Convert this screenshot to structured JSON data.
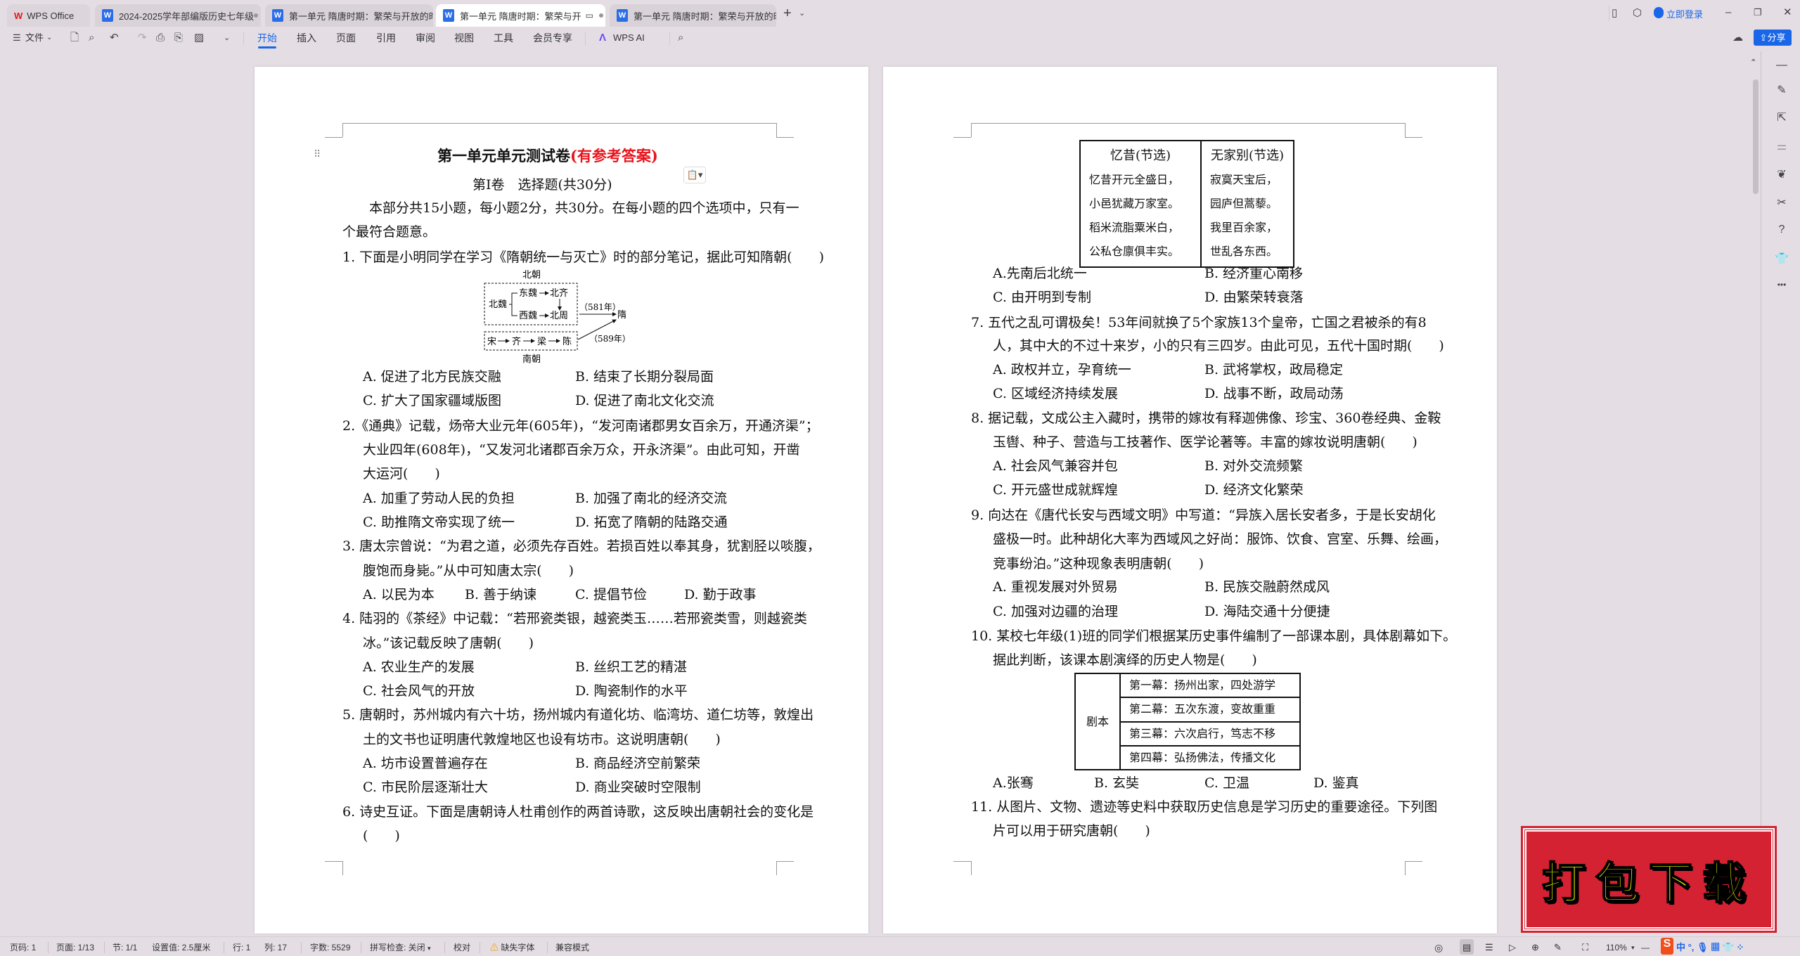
{
  "titlebar": {
    "app_tab": "WPS Office",
    "tabs": [
      {
        "label": "2024-2025学年部编版历史七年级",
        "active": false
      },
      {
        "label": "第一单元 隋唐时期：繁荣与开放的时代",
        "active": false
      },
      {
        "label": "第一单元 隋唐时期：繁荣与开",
        "active": true
      },
      {
        "label": "第一单元 隋唐时期：繁荣与开放的时代",
        "active": false
      }
    ],
    "new_tab": "+",
    "login": "立即登录",
    "share": "分享"
  },
  "ribbon": {
    "file": "文件",
    "tabs": [
      "开始",
      "插入",
      "页面",
      "引用",
      "审阅",
      "视图",
      "工具",
      "会员专享"
    ],
    "active_tab": "开始",
    "ai": "WPS AI"
  },
  "left_page": {
    "title": "第一单元单元测试卷",
    "title_note": "(有参考答案)",
    "section": "第Ⅰ卷　选择题(共30分)",
    "intro": [
      "本部分共15小题，每小题2分，共30分。在每小题的四个选项中，只有一",
      "个最符合题意。"
    ],
    "q1": {
      "stem": "1. 下面是小明同学在学习《隋朝统一与灭亡》时的部分笔记，据此可知隋朝(　　)",
      "diagram": {
        "north": "北朝",
        "south": "南朝",
        "beiwei": "北魏",
        "dongwei": "东魏",
        "beiqi": "北齐",
        "xiwei": "西魏",
        "beizhou": "北周",
        "y581": "（581年）",
        "y589": "（589年）",
        "sui": "隋",
        "song": "宋",
        "qi": "齐",
        "liang": "梁",
        "chen": "陈"
      },
      "A": "A.  促进了北方民族交融",
      "B": "B.  结束了长期分裂局面",
      "C": "C.  扩大了国家疆域版图",
      "D": "D.  促进了南北文化交流"
    },
    "q2": {
      "lines": [
        "2.《通典》记载，炀帝大业元年(605年)，“发河南诸郡男女百余万，开通济渠”；",
        "大业四年(608年)，“又发河北诸郡百余万众，开永济渠”。由此可知，开凿",
        "大运河(　　)"
      ],
      "A": "A.  加重了劳动人民的负担",
      "B": "B.  加强了南北的经济交流",
      "C": "C.  助推隋文帝实现了统一",
      "D": "D.  拓宽了隋朝的陆路交通"
    },
    "q3": {
      "lines": [
        "3. 唐太宗曾说：“为君之道，必须先存百姓。若损百姓以奉其身，犹割胫以啖腹，",
        "腹饱而身毙。”从中可知唐太宗(　　)"
      ],
      "A": "A.  以民为本",
      "B": "B.  善于纳谏",
      "C": "C.  提倡节俭",
      "D": "D.  勤于政事"
    },
    "q4": {
      "lines": [
        "4. 陆羽的《茶经》中记载：“若邢瓷类银，越瓷类玉……若邢瓷类雪，则越瓷类",
        "冰。”该记载反映了唐朝(　　)"
      ],
      "A": "A.  农业生产的发展",
      "B": "B.  丝织工艺的精湛",
      "C": "C.  社会风气的开放",
      "D": "D.  陶瓷制作的水平"
    },
    "q5": {
      "lines": [
        "5. 唐朝时，苏州城内有六十坊，扬州城内有道化坊、临湾坊、道仁坊等，敦煌出",
        "土的文书也证明唐代敦煌地区也设有坊市。这说明唐朝(　　)"
      ],
      "A": "A.  坊市设置普遍存在",
      "B": "B.  商品经济空前繁荣",
      "C": "C.  市民阶层逐渐壮大",
      "D": "D.  商业突破时空限制"
    },
    "q6": {
      "lines": [
        "6. 诗史互证。下面是唐朝诗人杜甫创作的两首诗歌，这反映出唐朝社会的变化是",
        "(　　)"
      ]
    }
  },
  "right_page": {
    "poems": [
      {
        "title": "忆昔(节选)",
        "lines": [
          "忆昔开元全盛日，",
          "小邑犹藏万家室。",
          "稻米流脂粟米白，",
          "公私仓廪俱丰实。"
        ]
      },
      {
        "title": "无家别(节选)",
        "lines": [
          "寂寞天宝后，",
          "园庐但蒿藜。",
          "我里百余家，",
          "世乱各东西。"
        ]
      }
    ],
    "q6_options": {
      "A": "A.先南后北统一",
      "B": "B.  经济重心南移",
      "C": "C.  由开明到专制",
      "D": "D.  由繁荣转衰落"
    },
    "q7": {
      "lines": [
        "7.  五代之乱可谓极矣！53年间就换了5个家族13个皇帝，亡国之君被杀的有8",
        "人，其中大的不过十来岁，小的只有三四岁。由此可见，五代十国时期(　　)"
      ],
      "A": "A.  政权并立，孕育统一",
      "B": "B.  武将掌权，政局稳定",
      "C": "C.  区域经济持续发展",
      "D": "D.  战事不断，政局动荡"
    },
    "q8": {
      "lines": [
        "8. 据记载，文成公主入藏时，携带的嫁妆有释迦佛像、珍宝、360卷经典、金鞍",
        "玉辔、种子、营造与工技著作、医学论著等。丰富的嫁妆说明唐朝(　　)"
      ],
      "A": "A.  社会风气兼容并包",
      "B": "B.  对外交流频繁",
      "C": "C.  开元盛世成就辉煌",
      "D": "D.  经济文化繁荣"
    },
    "q9": {
      "lines": [
        "9. 向达在《唐代长安与西域文明》中写道：“异族入居长安者多，于是长安胡化",
        "盛极一时。此种胡化大率为西域风之好尚：服饰、饮食、宫室、乐舞、绘画，",
        "竞事纷泊。”这种现象表明唐朝(　　)"
      ],
      "A": "A.  重视发展对外贸易",
      "B": "B.  民族交融蔚然成风",
      "C": "C.  加强对边疆的治理",
      "D": "D.  海陆交通十分便捷"
    },
    "q10": {
      "lines": [
        "10. 某校七年级(1)班的同学们根据某历史事件编制了一部课本剧，具体剧幕如下。",
        "据此判断，该课本剧演绎的历史人物是(　　)"
      ],
      "table_label": "剧本",
      "acts": [
        "第一幕：扬州出家，四处游学",
        "第二幕：五次东渡，变故重重",
        "第三幕：六次启行，笃志不移",
        "第四幕：弘扬佛法，传播文化"
      ],
      "A": "A.张骞",
      "B": "B.  玄奘",
      "C": "C.  卫温",
      "D": "D.  鉴真"
    },
    "q11": {
      "lines": [
        "11.  从图片、文物、遗迹等史料中获取历史信息是学习历史的重要途径。下列图",
        "片可以用于研究唐朝(　　)"
      ]
    }
  },
  "stamp": "打包下载",
  "statusbar": {
    "page_no": "页码: 1",
    "pages": "页面: 1/13",
    "section": "节: 1/1",
    "setting": "设置值: 2.5厘米",
    "row": "行: 1",
    "col": "列: 17",
    "words": "字数: 5529",
    "spell": "拼写检查: 关闭",
    "proof": "校对",
    "missing_font": "缺失字体",
    "compat": "兼容模式",
    "zoom": "110%"
  },
  "colors": {
    "accent": "#1a66e8",
    "title_red": "#e8141c",
    "stamp_red": "#d42232",
    "stamp_yellow": "#f5ff00",
    "background": "#e4dee4"
  }
}
